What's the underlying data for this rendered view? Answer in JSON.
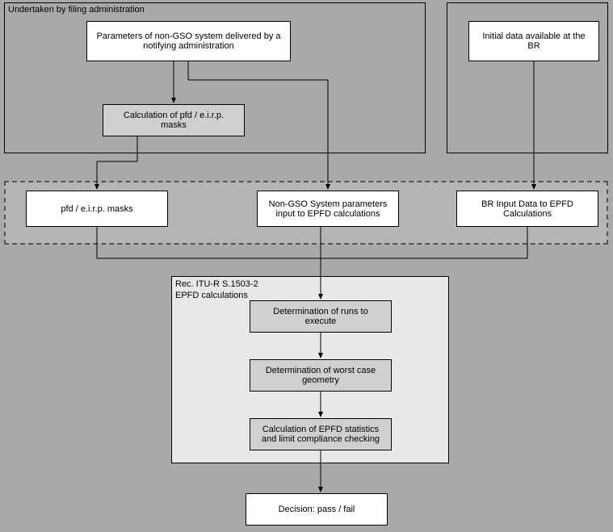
{
  "containers": {
    "filing_admin_label": "Undertaken by filing administration",
    "rec_label_line1": "Rec. ITU-R S.1503-2",
    "rec_label_line2": "EPFD calculations"
  },
  "boxes": {
    "params_nongso": "Parameters of non-GSO system delivered by a notifying administration",
    "initial_data_br": "Initial data available at the BR",
    "calc_pfd_masks": "Calculation of pfd / e.i.r.p. masks",
    "pfd_masks": "pfd / e.i.r.p. masks",
    "nongso_params_input": "Non-GSO System parameters input to EPFD calculations",
    "br_input_data": "BR Input Data to EPFD Calculations",
    "determination_runs": "Determination of runs to execute",
    "determination_worst": "Determination of worst case geometry",
    "calc_epfd_stats": "Calculation of EPFD statistics and limit compliance checking",
    "decision": "Decision: pass / fail"
  }
}
